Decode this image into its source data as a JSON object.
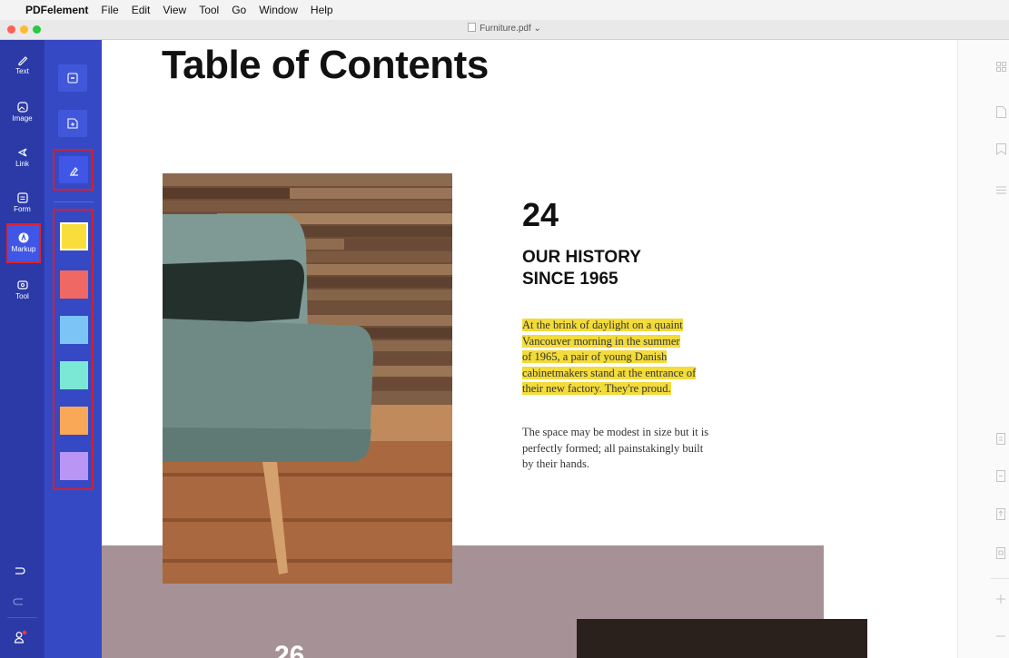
{
  "menubar": {
    "app_name": "PDFelement",
    "items": [
      "File",
      "Edit",
      "View",
      "Tool",
      "Go",
      "Window",
      "Help"
    ]
  },
  "window": {
    "doc_title": "Furniture.pdf ⌄",
    "traffic_lights": [
      "#ff5f57",
      "#febc2e",
      "#28c840"
    ]
  },
  "sidebar": {
    "items": [
      {
        "label": "Text",
        "icon": "pencil-icon"
      },
      {
        "label": "Image",
        "icon": "image-icon"
      },
      {
        "label": "Link",
        "icon": "link-icon"
      },
      {
        "label": "Form",
        "icon": "form-icon"
      },
      {
        "label": "Markup",
        "icon": "markup-icon",
        "active": true
      },
      {
        "label": "Tool",
        "icon": "tool-icon"
      }
    ],
    "bottom_icons": [
      "undo-icon",
      "redo-icon",
      "account-icon"
    ]
  },
  "markup_tools": {
    "tools": [
      "textbox-icon",
      "insert-icon",
      "highlight-icon"
    ],
    "colors": [
      "#f9de3b",
      "#ef6863",
      "#7cc4f5",
      "#7be8d6",
      "#f8a857",
      "#b995f4"
    ]
  },
  "document": {
    "title": "Table of Contents",
    "page_number": "24",
    "heading_line1": "OUR HISTORY",
    "heading_line2": "SINCE 1965",
    "highlighted_lines": [
      "At the brink of daylight on a quaint",
      "Vancouver morning in the summer",
      "of 1965, a pair of young Danish",
      "cabinetmakers stand at the entrance of",
      "their new factory. They're proud."
    ],
    "body_lines": [
      "The space may be modest in size but it is",
      "perfectly formed; all painstakingly built",
      "by their hands."
    ],
    "next_page_number": "26"
  },
  "colors": {
    "sidebar_bg": "#2c3aa8",
    "subbar_bg": "#3649c4",
    "active_item": "#3f56e6",
    "highlight": "#f3db3a",
    "callout_red": "#d81f2a",
    "section_bg": "#a69296"
  }
}
